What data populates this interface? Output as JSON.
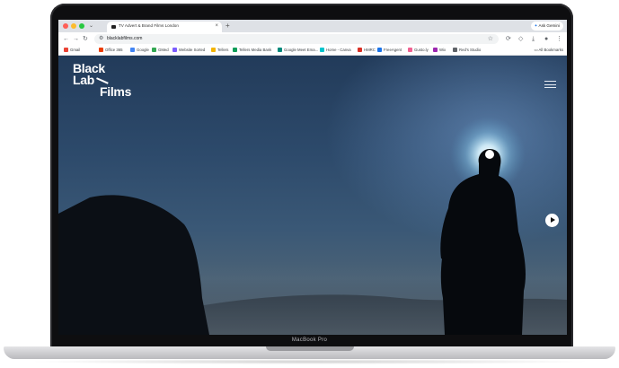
{
  "device": {
    "label": "MacBook Pro"
  },
  "browser": {
    "tab": {
      "title": "TV Advert & Brand Films London",
      "close_glyph": "×"
    },
    "new_tab_glyph": "+",
    "tab_search_glyph": "⌄",
    "gemini_label": "Ask Gemini",
    "address": {
      "url": "blacklabfilms.com"
    },
    "bookmarks": [
      {
        "label": "Gmail",
        "color": "#ea4335"
      },
      {
        "label": "Office 365",
        "color": "#eb3c00"
      },
      {
        "label": "Google",
        "color": "#4285f4"
      },
      {
        "label": "GMed",
        "color": "#34a853"
      },
      {
        "label": "Website Sorted",
        "color": "#7b5cff"
      },
      {
        "label": "Tellers",
        "color": "#f4b400"
      },
      {
        "label": "Tellers Media Bank",
        "color": "#0f9d58"
      },
      {
        "label": "Google Meet Ema...",
        "color": "#00897b"
      },
      {
        "label": "Home - Canva",
        "color": "#00c4cc"
      },
      {
        "label": "HMRC",
        "color": "#d93025"
      },
      {
        "label": "FreeAgent",
        "color": "#1a73e8"
      },
      {
        "label": "Gusto.ly",
        "color": "#f06292"
      },
      {
        "label": "Wix",
        "color": "#9c27b0"
      },
      {
        "label": "Red's Studio",
        "color": "#5f6368"
      }
    ],
    "bookmarks_folder": "All Bookmarks"
  },
  "site": {
    "logo": {
      "line1": "Black",
      "line2": "Lab",
      "line3": "Films"
    },
    "menu_icon": "hamburger-icon",
    "play_icon": "play-icon"
  }
}
